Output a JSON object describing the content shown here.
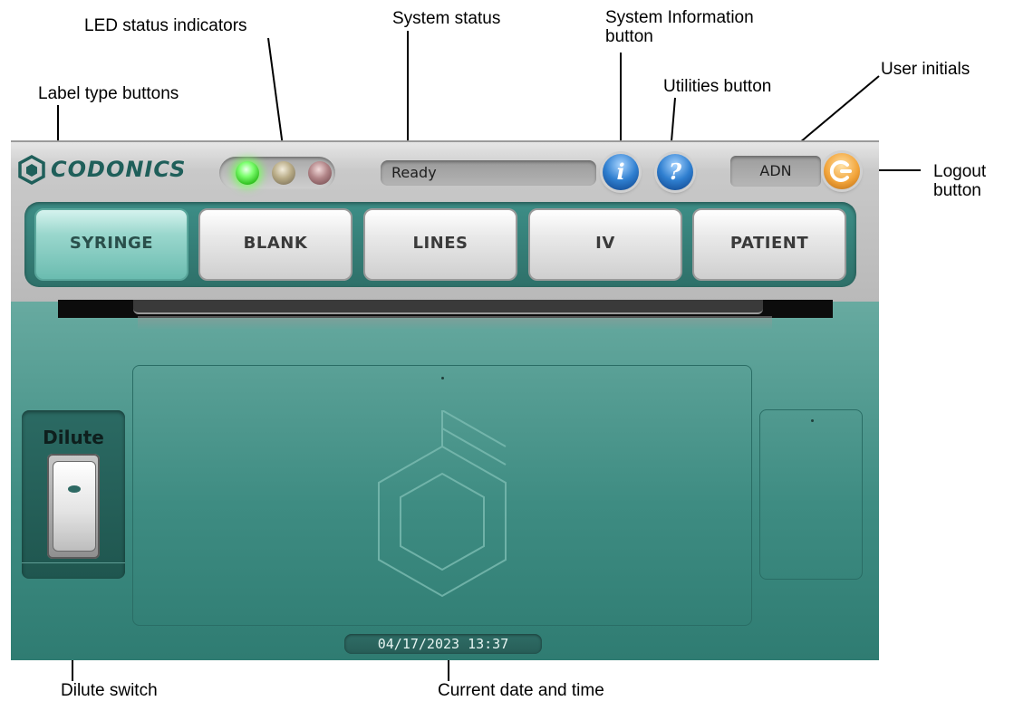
{
  "callouts": {
    "led_status": "LED status indicators",
    "system_status": "System status",
    "system_info_line1": "System Information",
    "system_info_line2": "button",
    "user_initials": "User initials",
    "utilities": "Utilities button",
    "label_type": "Label type buttons",
    "logout_line1": "Logout",
    "logout_line2": "button",
    "dilute_switch": "Dilute switch",
    "datetime": "Current date and time"
  },
  "header": {
    "logo": "CODONICS",
    "leds": [
      {
        "name": "green",
        "state": "on",
        "color": "#5fff44"
      },
      {
        "name": "amber",
        "state": "off",
        "color": "#b8ab86"
      },
      {
        "name": "red",
        "state": "off",
        "color": "#b18487"
      }
    ],
    "status": "Ready",
    "info_icon": "i",
    "utilities_icon": "?",
    "user_initials": "ADN",
    "logout_icon": "power-icon"
  },
  "tabs": [
    {
      "label": "SYRINGE",
      "active": true
    },
    {
      "label": "BLANK",
      "active": false
    },
    {
      "label": "LINES",
      "active": false
    },
    {
      "label": "IV",
      "active": false
    },
    {
      "label": "PATIENT",
      "active": false
    }
  ],
  "dilute": {
    "label": "Dilute",
    "state": "off"
  },
  "datetime": "04/17/2023 13:37",
  "colors": {
    "accent": "#2f7c72",
    "active_tab": "#9ad7cd"
  }
}
